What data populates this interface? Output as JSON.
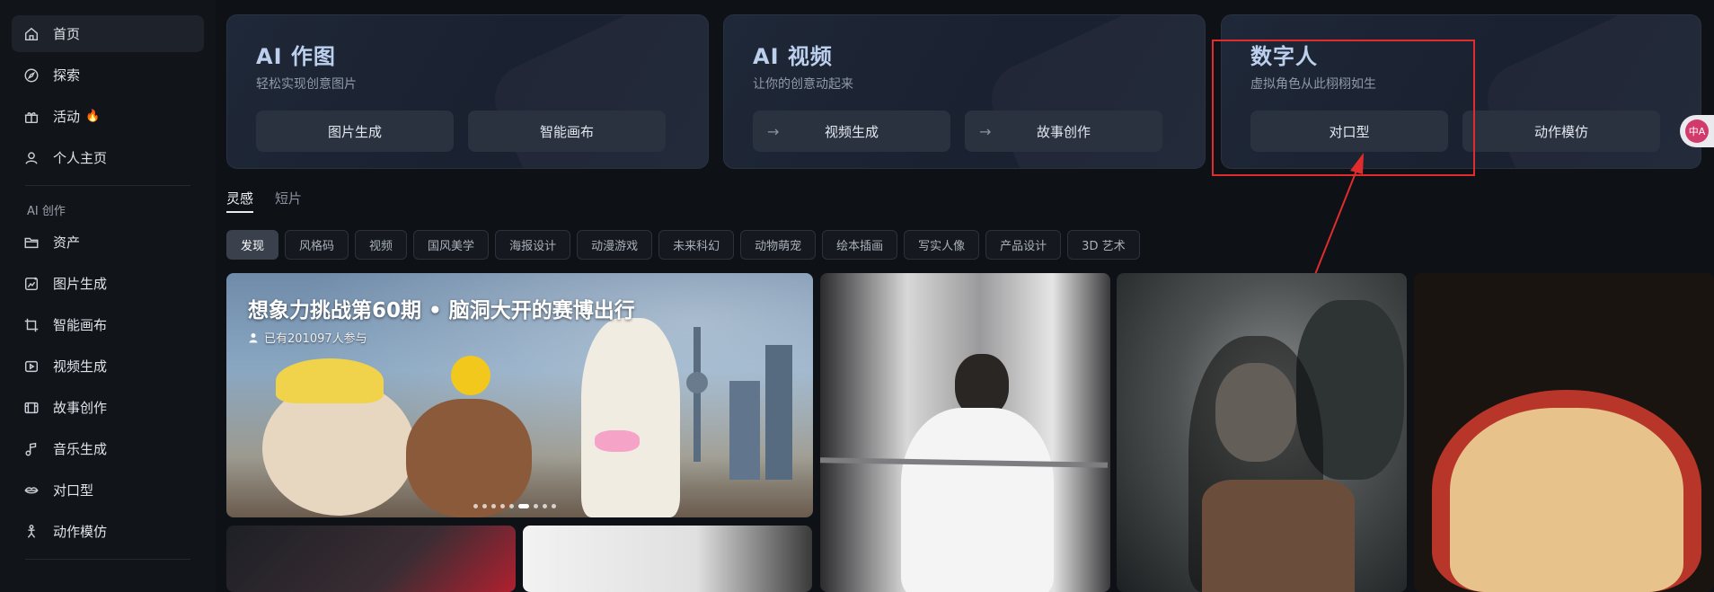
{
  "sidebar": {
    "items_top": [
      {
        "label": "首页",
        "icon": "home-icon",
        "active": true
      },
      {
        "label": "探索",
        "icon": "compass-icon"
      },
      {
        "label": "活动",
        "icon": "gift-icon",
        "badge": "🔥"
      },
      {
        "label": "个人主页",
        "icon": "user-icon"
      }
    ],
    "section_label": "AI 创作",
    "items_create": [
      {
        "label": "资产",
        "icon": "folder-icon"
      },
      {
        "label": "图片生成",
        "icon": "image-gen-icon"
      },
      {
        "label": "智能画布",
        "icon": "crop-icon"
      },
      {
        "label": "视频生成",
        "icon": "video-icon"
      },
      {
        "label": "故事创作",
        "icon": "story-icon"
      },
      {
        "label": "音乐生成",
        "icon": "music-icon"
      },
      {
        "label": "对口型",
        "icon": "lipsync-icon"
      },
      {
        "label": "动作模仿",
        "icon": "motion-icon"
      }
    ]
  },
  "cards": [
    {
      "title": "AI 作图",
      "subtitle": "轻松实现创意图片",
      "buttons": [
        "图片生成",
        "智能画布"
      ]
    },
    {
      "title": "AI 视频",
      "subtitle": "让你的创意动起来",
      "buttons": [
        "视频生成",
        "故事创作"
      ]
    },
    {
      "title": "数字人",
      "subtitle": "虚拟角色从此栩栩如生",
      "buttons": [
        "对口型",
        "动作模仿"
      ]
    }
  ],
  "tabs": [
    "灵感",
    "短片"
  ],
  "chips": [
    "发现",
    "风格码",
    "视频",
    "国风美学",
    "海报设计",
    "动漫游戏",
    "未来科幻",
    "动物萌宠",
    "绘本插画",
    "写实人像",
    "产品设计",
    "3D 艺术"
  ],
  "banner": {
    "title": "想象力挑战第60期 • 脑洞大开的赛博出行",
    "participants": "已有201097人参与"
  },
  "float_avatar_text": "中A",
  "colors": {
    "accent": "#bcd0ee",
    "annotation": "#e02c2c",
    "background": "#0e1116"
  }
}
